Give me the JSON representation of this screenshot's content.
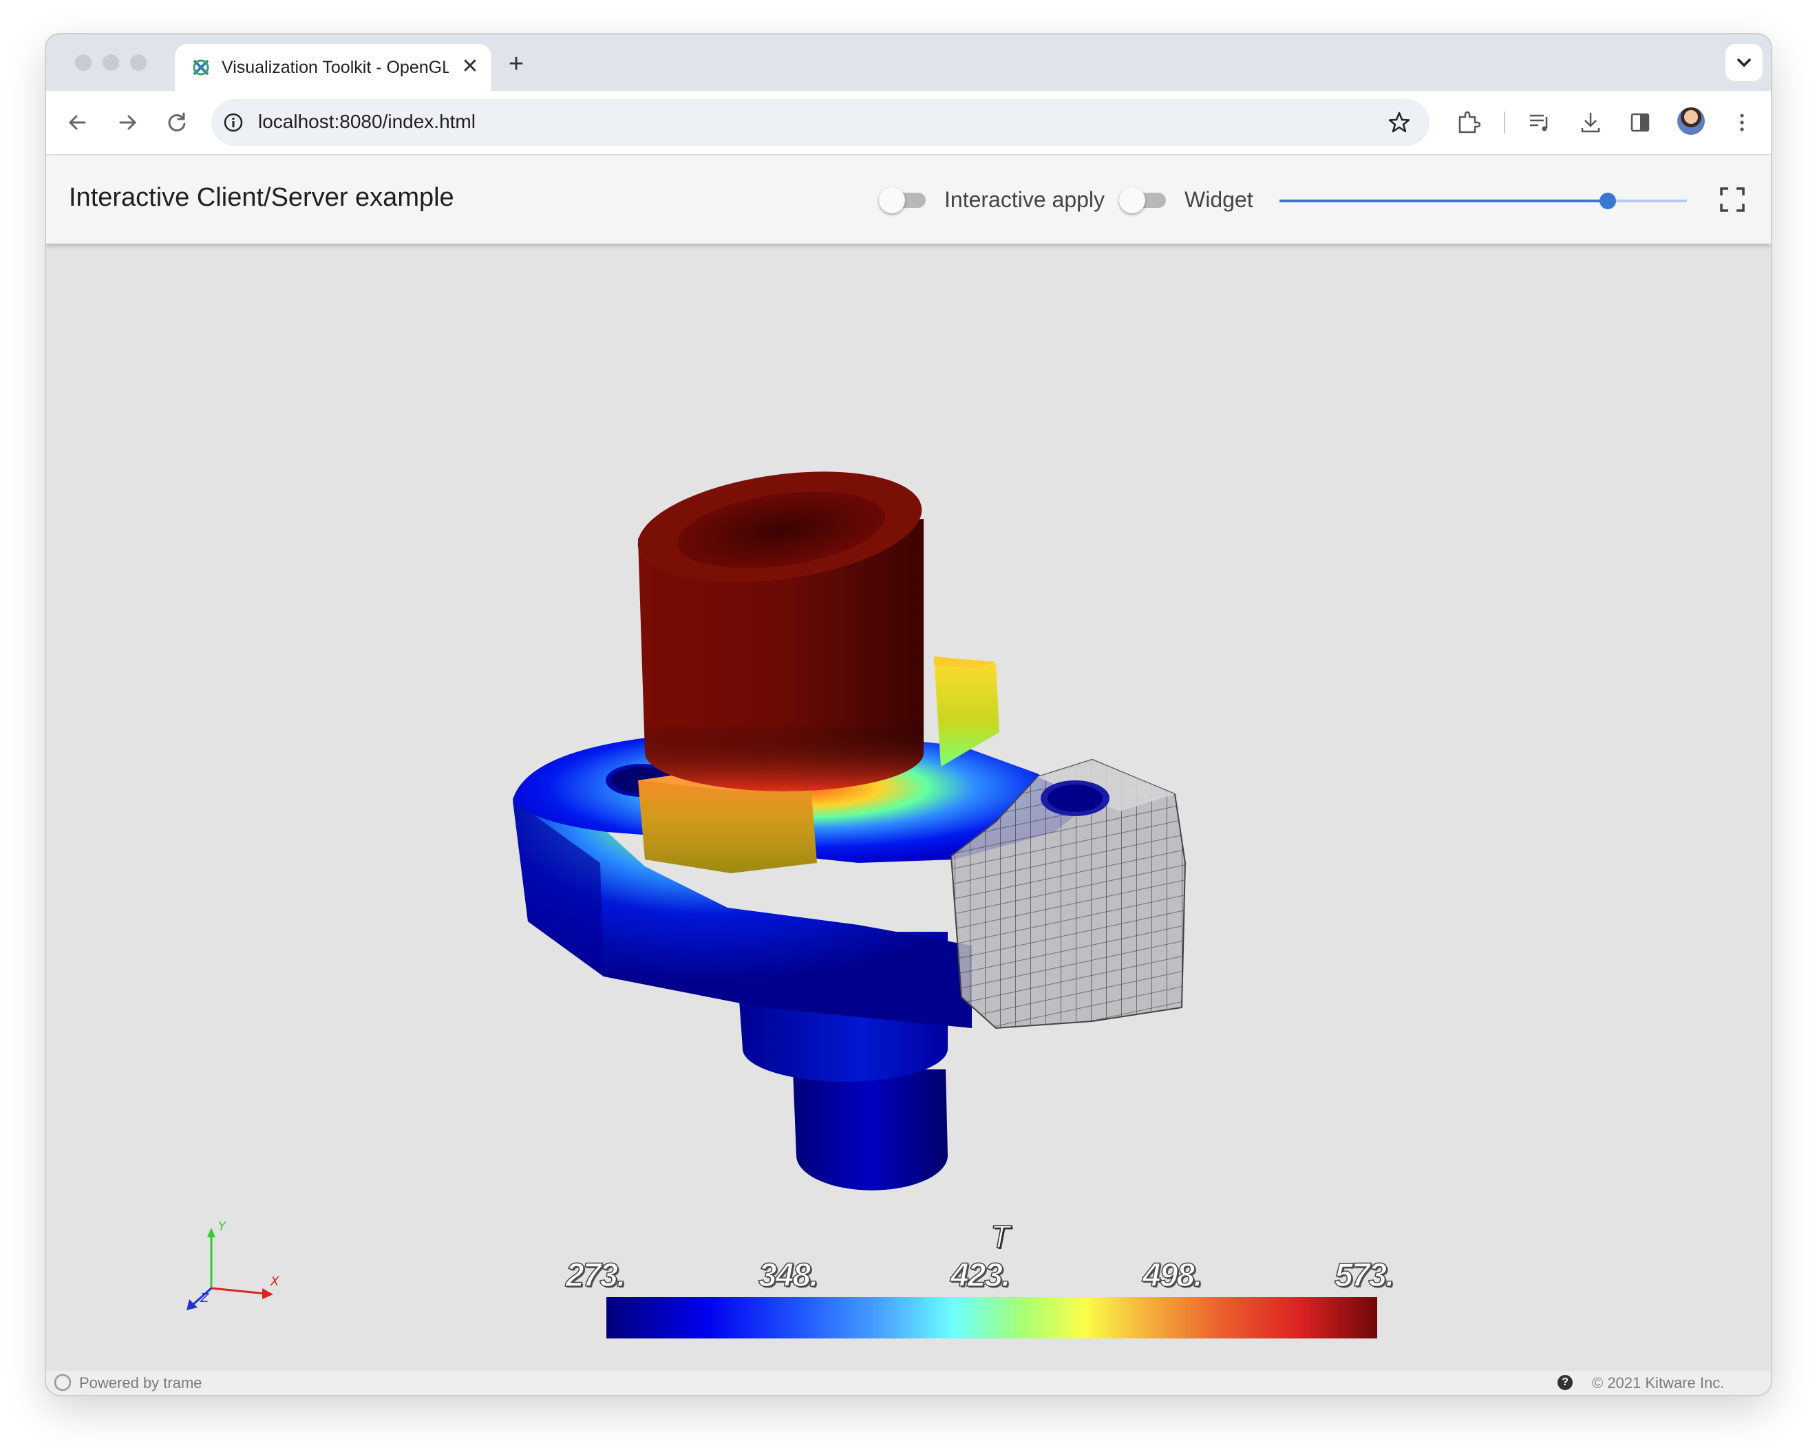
{
  "browser": {
    "tab_title": "Visualization Toolkit - OpenGL",
    "tab_close": "✕",
    "new_tab": "+",
    "url": "localhost:8080/index.html"
  },
  "app": {
    "title": "Interactive Client/Server example",
    "toggles": [
      {
        "label": "Interactive apply",
        "checked": false
      },
      {
        "label": "Widget",
        "checked": false
      }
    ],
    "slider_value_fraction": 0.805
  },
  "viewport": {
    "colorbar": {
      "title": "T",
      "ticks": [
        "273.",
        "348.",
        "423.",
        "498.",
        "573."
      ],
      "colormap": [
        "#00007a",
        "#0000ee",
        "#4aa6ff",
        "#6dffff",
        "#fbff4a",
        "#ea5e2c",
        "#700808"
      ]
    },
    "axes": {
      "x": "X",
      "y": "Y",
      "z": "Z"
    }
  },
  "footer": {
    "left_text": "Powered by trame",
    "help": "?",
    "right_text": "© 2021 Kitware Inc."
  }
}
